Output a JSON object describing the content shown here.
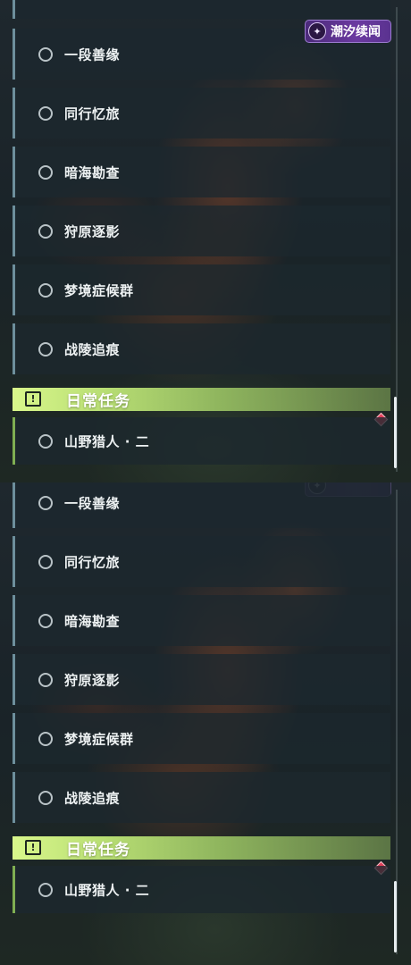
{
  "badge": {
    "label": "潮汐续闻",
    "icon": "tidal-emblem-icon"
  },
  "quests": [
    {
      "label": "一段善缘"
    },
    {
      "label": "同行忆旅"
    },
    {
      "label": "暗海勘查"
    },
    {
      "label": "狩原逐影"
    },
    {
      "label": "梦境症候群"
    },
    {
      "label": "战陵追痕"
    }
  ],
  "daily_section": {
    "title": "日常任务",
    "icon": "exclamation-icon",
    "item": {
      "label": "山野猎人 · 二"
    }
  },
  "colors": {
    "daily_accent": "#b7dd73",
    "quest_border": "#6d8f9c",
    "daily_border": "#7fae52",
    "badge_purple": "#6b3aa0",
    "marker_red": "#e0405a"
  }
}
